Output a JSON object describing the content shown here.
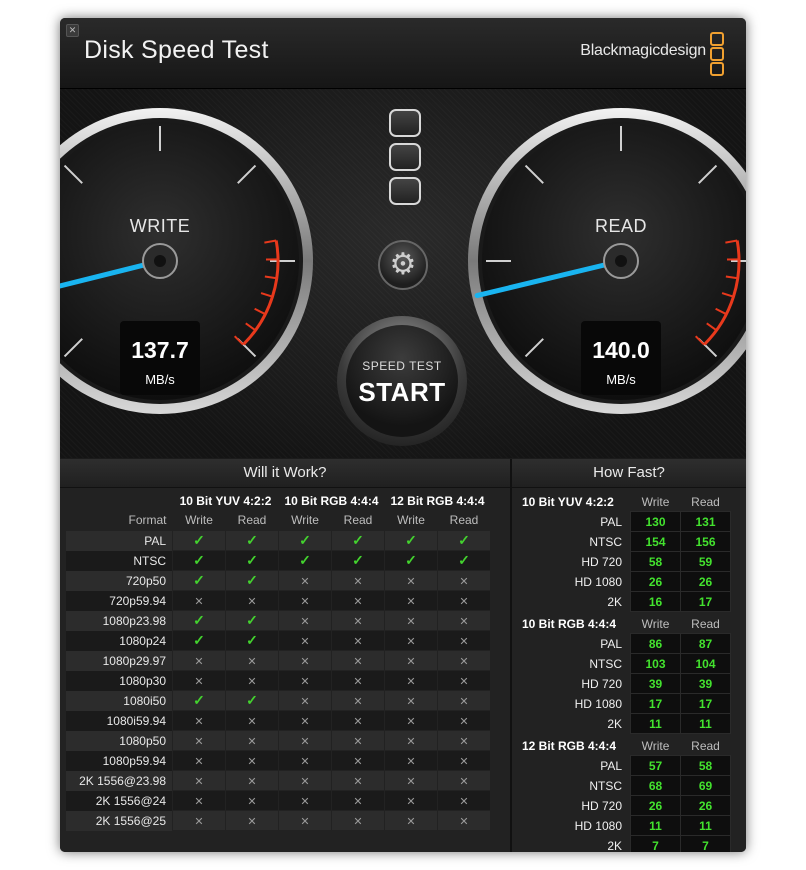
{
  "window": {
    "title": "Disk Speed Test",
    "brand": "Blackmagicdesign"
  },
  "gauges": {
    "write": {
      "label": "WRITE",
      "value": "137.7",
      "unit": "MB/s",
      "needle_mbps": 137.7,
      "needle_color": "#19b4f0"
    },
    "read": {
      "label": "READ",
      "value": "140.0",
      "unit": "MB/s",
      "needle_mbps": 140.0,
      "needle_color": "#19b4f0"
    },
    "danger_color": "#e8391c"
  },
  "controls": {
    "settings_icon": "gear-icon",
    "start_small": "SPEED TEST",
    "start_big": "START"
  },
  "will_it_work": {
    "title": "Will it Work?",
    "format_label": "Format",
    "groups": [
      "10 Bit YUV 4:2:2",
      "10 Bit RGB 4:4:4",
      "12 Bit RGB 4:4:4"
    ],
    "cols": [
      "Write",
      "Read",
      "Write",
      "Read",
      "Write",
      "Read"
    ],
    "rows": [
      {
        "format": "PAL",
        "cells": [
          1,
          1,
          1,
          1,
          1,
          1
        ]
      },
      {
        "format": "NTSC",
        "cells": [
          1,
          1,
          1,
          1,
          1,
          1
        ]
      },
      {
        "format": "720p50",
        "cells": [
          1,
          1,
          0,
          0,
          0,
          0
        ]
      },
      {
        "format": "720p59.94",
        "cells": [
          0,
          0,
          0,
          0,
          0,
          0
        ]
      },
      {
        "format": "1080p23.98",
        "cells": [
          1,
          1,
          0,
          0,
          0,
          0
        ]
      },
      {
        "format": "1080p24",
        "cells": [
          1,
          1,
          0,
          0,
          0,
          0
        ]
      },
      {
        "format": "1080p29.97",
        "cells": [
          0,
          0,
          0,
          0,
          0,
          0
        ]
      },
      {
        "format": "1080p30",
        "cells": [
          0,
          0,
          0,
          0,
          0,
          0
        ]
      },
      {
        "format": "1080i50",
        "cells": [
          1,
          1,
          0,
          0,
          0,
          0
        ]
      },
      {
        "format": "1080i59.94",
        "cells": [
          0,
          0,
          0,
          0,
          0,
          0
        ]
      },
      {
        "format": "1080p50",
        "cells": [
          0,
          0,
          0,
          0,
          0,
          0
        ]
      },
      {
        "format": "1080p59.94",
        "cells": [
          0,
          0,
          0,
          0,
          0,
          0
        ]
      },
      {
        "format": "2K 1556@23.98",
        "cells": [
          0,
          0,
          0,
          0,
          0,
          0
        ]
      },
      {
        "format": "2K 1556@24",
        "cells": [
          0,
          0,
          0,
          0,
          0,
          0
        ]
      },
      {
        "format": "2K 1556@25",
        "cells": [
          0,
          0,
          0,
          0,
          0,
          0
        ]
      }
    ]
  },
  "how_fast": {
    "title": "How Fast?",
    "write_label": "Write",
    "read_label": "Read",
    "groups": [
      {
        "name": "10 Bit YUV 4:2:2",
        "rows": [
          {
            "format": "PAL",
            "write": "130",
            "read": "131"
          },
          {
            "format": "NTSC",
            "write": "154",
            "read": "156"
          },
          {
            "format": "HD 720",
            "write": "58",
            "read": "59"
          },
          {
            "format": "HD 1080",
            "write": "26",
            "read": "26"
          },
          {
            "format": "2K",
            "write": "16",
            "read": "17"
          }
        ]
      },
      {
        "name": "10 Bit RGB 4:4:4",
        "rows": [
          {
            "format": "PAL",
            "write": "86",
            "read": "87"
          },
          {
            "format": "NTSC",
            "write": "103",
            "read": "104"
          },
          {
            "format": "HD 720",
            "write": "39",
            "read": "39"
          },
          {
            "format": "HD 1080",
            "write": "17",
            "read": "17"
          },
          {
            "format": "2K",
            "write": "11",
            "read": "11"
          }
        ]
      },
      {
        "name": "12 Bit RGB 4:4:4",
        "rows": [
          {
            "format": "PAL",
            "write": "57",
            "read": "58"
          },
          {
            "format": "NTSC",
            "write": "68",
            "read": "69"
          },
          {
            "format": "HD 720",
            "write": "26",
            "read": "26"
          },
          {
            "format": "HD 1080",
            "write": "11",
            "read": "11"
          },
          {
            "format": "2K",
            "write": "7",
            "read": "7"
          }
        ]
      }
    ]
  }
}
